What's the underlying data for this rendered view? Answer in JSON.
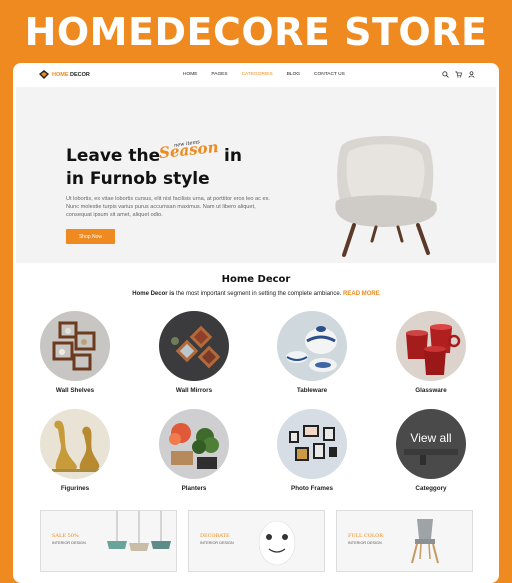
{
  "banner": {
    "title": "HOMEDECORE STORE"
  },
  "nav": {
    "logo": {
      "prefix": "HOME",
      "suffix": " DECOR"
    },
    "items": [
      "HOME",
      "PAGES",
      "CATEGORIES",
      "BLOG",
      "CONTACT US"
    ],
    "active_item": "CATEGORIES",
    "icons": [
      "search-icon",
      "cart-icon",
      "user-icon"
    ]
  },
  "hero": {
    "title_line1_start": "Leave the",
    "title_script": "Season",
    "title_script_small": "new items",
    "title_line1_end": "in",
    "title_line2": "in Furnob style",
    "paragraph": "Ut lobortis, ex vitae lobortis cursus, elit nisl facilisis urna, at porttitor eros leo ac ex. Nunc molestie turpis varius purus accumsan maximus. Nam ut libero aliquet, consequat ipsum sit amet, aliquet odio.",
    "button": "Shop Now"
  },
  "section": {
    "title": "Home Decor",
    "subtitle_bold": "Home Decor is",
    "subtitle_rest": " the most important segment in setting the complete ambiance. ",
    "read_more": "READ MORE"
  },
  "categories": [
    {
      "label": "Wall Shelves",
      "icon": "wall-shelves"
    },
    {
      "label": "Wall Mirrors",
      "icon": "wall-mirrors"
    },
    {
      "label": "Tableware",
      "icon": "tableware"
    },
    {
      "label": "Glassware",
      "icon": "glassware"
    },
    {
      "label": "Figurines",
      "icon": "figurines"
    },
    {
      "label": "Planters",
      "icon": "planters"
    },
    {
      "label": "Photo Frames",
      "icon": "photo-frames"
    },
    {
      "label": "Categgory",
      "icon": "view-all",
      "overlay": "View all"
    }
  ],
  "promos": [
    {
      "title": "SALE 50%",
      "subtitle": "INTERIOR DESIGN"
    },
    {
      "title": "DECORATE",
      "subtitle": "INTERIOR DESIGN"
    },
    {
      "title": "FULL COLOR",
      "subtitle": "INTERIOR DESIGN"
    }
  ],
  "colors": {
    "accent": "#ee8a1f",
    "banner_bg": "#ee8a1f",
    "hero_bg": "#f3f3f3"
  }
}
